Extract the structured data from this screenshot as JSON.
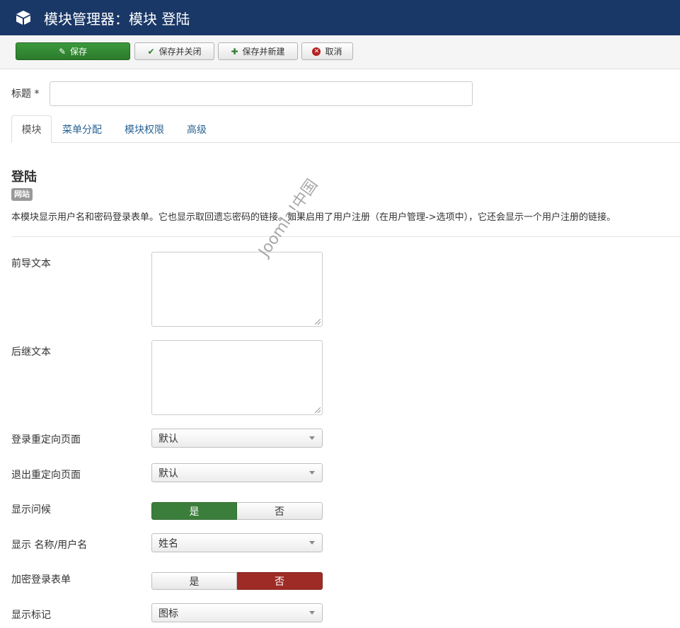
{
  "header": {
    "icon": "cube-icon",
    "title": "模块管理器：模块 登陆"
  },
  "toolbar": {
    "save_label": "保存",
    "save_close_label": "保存并关闭",
    "save_new_label": "保存并新建",
    "cancel_label": "取消"
  },
  "form": {
    "title_label": "标题",
    "title_required_mark": "*",
    "title_value": ""
  },
  "tabs": [
    {
      "label": "模块",
      "active": true
    },
    {
      "label": "菜单分配",
      "active": false
    },
    {
      "label": "模块权限",
      "active": false
    },
    {
      "label": "高级",
      "active": false
    }
  ],
  "module": {
    "name": "登陆",
    "badge": "网站",
    "description": "本模块显示用户名和密码登录表单。它也显示取回遗忘密码的链接。如果启用了用户注册（在用户管理->选项中），它还会显示一个用户注册的链接。"
  },
  "fields": {
    "pretext_label": "前导文本",
    "pretext_value": "",
    "posttext_label": "后继文本",
    "posttext_value": "",
    "login_redirect_label": "登录重定向页面",
    "login_redirect_value": "默认",
    "logout_redirect_label": "退出重定向页面",
    "logout_redirect_value": "默认",
    "greeting_label": "显示问候",
    "greeting_yes": "是",
    "greeting_no": "否",
    "greeting_selected": "是",
    "name_label": "显示 名称/用户名",
    "name_value": "姓名",
    "encrypt_label": "加密登录表单",
    "encrypt_yes": "是",
    "encrypt_no": "否",
    "encrypt_selected": "否",
    "show_label_label": "显示标记",
    "show_label_value": "图标"
  },
  "watermark": "Joomla!中国",
  "colors": {
    "header_bg": "#1a3867",
    "save_green": "#2b7a2b",
    "toggle_green": "#3b7e3b",
    "toggle_red": "#9e2b25",
    "link_blue": "#2a6496"
  }
}
